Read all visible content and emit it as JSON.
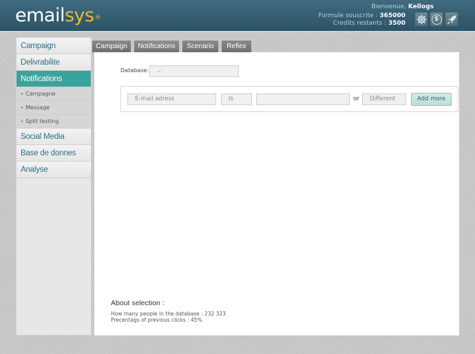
{
  "header": {
    "logo_part1": "email",
    "logo_part2": "sys",
    "logo_reg": "®",
    "welcome_prefix": "Bienvenue,",
    "user_name": "Kellogs",
    "plan_label": "Formule souscrite :",
    "plan_value": "365000",
    "credits_label": "Credits restants :",
    "credits_value": "3500",
    "icons": [
      "settings-gear-icon",
      "dollar-coin-icon",
      "rocket-icon"
    ],
    "currency_glyph": "$"
  },
  "sidebar": {
    "items": [
      {
        "label": "Campaign"
      },
      {
        "label": "Delivrabilite"
      },
      {
        "label": "Notifications",
        "active": true
      },
      {
        "label": "Social Media"
      },
      {
        "label": "Base de donnes"
      },
      {
        "label": "Analyse"
      }
    ],
    "sub_items": [
      {
        "label": "Campagne"
      },
      {
        "label": "Message"
      },
      {
        "label": "Split testing"
      }
    ],
    "bullet": "•"
  },
  "tabs": [
    {
      "label": "Campaign"
    },
    {
      "label": "Notifications"
    },
    {
      "label": "Scenario"
    },
    {
      "label": "Reflex"
    }
  ],
  "form": {
    "database_label": "Database:",
    "database_value": "--",
    "field_placeholder": "E-mail adress",
    "operator_placeholder": "Is",
    "value_placeholder": "",
    "or_text": "or",
    "alt_placeholder": "Different",
    "add_more_label": "Add more"
  },
  "about": {
    "title": "About selection :",
    "line1": "How many people in the database : 232 323",
    "line2": "Precentags of previous clicks : 45%"
  },
  "colors": {
    "header_bg": "#335a6d",
    "accent": "#3aa39c",
    "logo_accent": "#e7b73a",
    "link": "#2f6f86"
  }
}
